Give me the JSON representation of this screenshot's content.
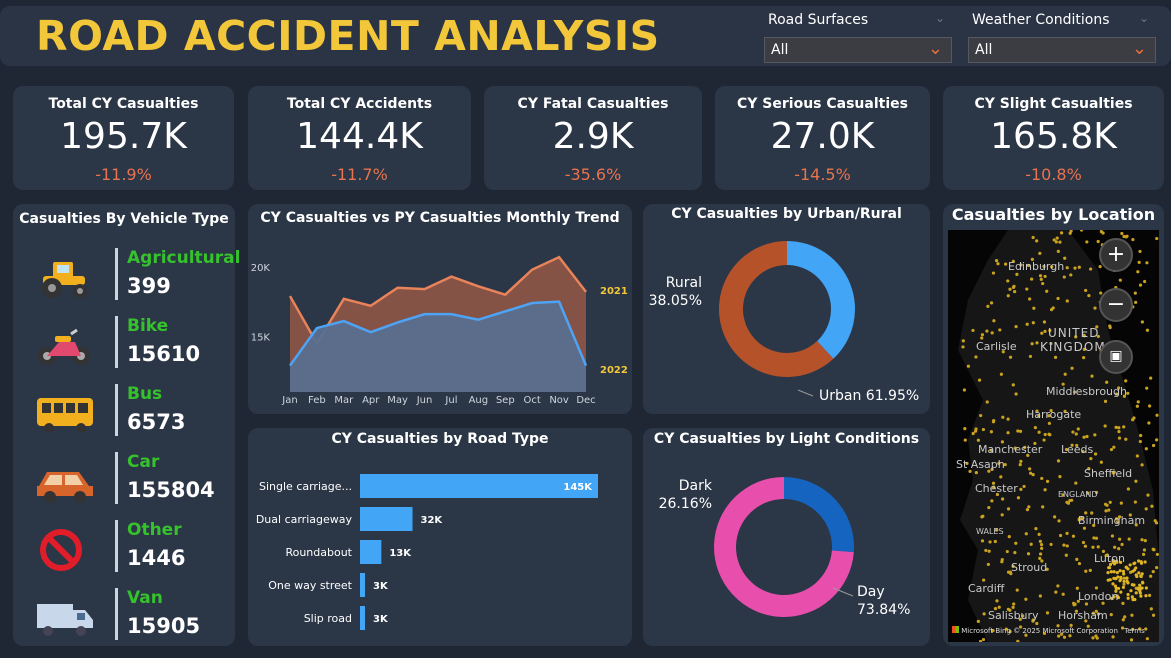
{
  "title": "ROAD ACCIDENT ANALYSIS",
  "slicers": [
    {
      "label": "Road Surfaces",
      "value": "All"
    },
    {
      "label": "Weather Conditions",
      "value": "All"
    }
  ],
  "kpis": [
    {
      "title": "Total CY Casualties",
      "value": "195.7K",
      "change": "-11.9%"
    },
    {
      "title": "Total CY Accidents",
      "value": "144.4K",
      "change": "-11.7%"
    },
    {
      "title": "CY Fatal Casualties",
      "value": "2.9K",
      "change": "-35.6%"
    },
    {
      "title": "CY Serious Casualties",
      "value": "27.0K",
      "change": "-14.5%"
    },
    {
      "title": "CY Slight Casualties",
      "value": "165.8K",
      "change": "-10.8%"
    }
  ],
  "vehicles": {
    "title": "Casualties By Vehicle Type",
    "items": [
      {
        "name": "Agricultural",
        "value": "399",
        "icon": "tractor-icon"
      },
      {
        "name": "Bike",
        "value": "15610",
        "icon": "motorbike-icon"
      },
      {
        "name": "Bus",
        "value": "6573",
        "icon": "bus-icon"
      },
      {
        "name": "Car",
        "value": "155804",
        "icon": "car-icon"
      },
      {
        "name": "Other",
        "value": "1446",
        "icon": "prohibited-icon"
      },
      {
        "name": "Van",
        "value": "15905",
        "icon": "van-icon"
      }
    ]
  },
  "chart_data": [
    {
      "type": "area",
      "title": "CY Casualties vs PY Casualties Monthly Trend",
      "categories": [
        "Jan",
        "Feb",
        "Mar",
        "Apr",
        "May",
        "Jun",
        "Jul",
        "Aug",
        "Sep",
        "Oct",
        "Nov",
        "Dec"
      ],
      "y_ticks": [
        "20K",
        "15K"
      ],
      "ylim": [
        11000,
        21500
      ],
      "series": [
        {
          "name": "2021",
          "color": "#e8835a",
          "values": [
            17900,
            14500,
            17700,
            17200,
            18500,
            18400,
            19300,
            18600,
            18000,
            19800,
            20700,
            18200
          ]
        },
        {
          "name": "2022",
          "color": "#4ea3f5",
          "values": [
            12900,
            15600,
            16100,
            15300,
            16000,
            16600,
            16600,
            16200,
            16800,
            17400,
            17500,
            12900
          ]
        }
      ]
    },
    {
      "type": "pie",
      "title": "CY Casualties by Urban/Rural",
      "slices": [
        {
          "label": "Rural",
          "value": 38.05,
          "display": "38.05%",
          "color": "#42a5f5"
        },
        {
          "label": "Urban",
          "value": 61.95,
          "display": "61.95%",
          "color": "#b5522a"
        }
      ]
    },
    {
      "type": "bar",
      "title": "CY Casualties by Road Type",
      "categories": [
        "Single carriage...",
        "Dual carriageway",
        "Roundabout",
        "One way street",
        "Slip road"
      ],
      "values": [
        145000,
        32000,
        13000,
        3000,
        3000
      ],
      "labels": [
        "145K",
        "32K",
        "13K",
        "3K",
        "3K"
      ]
    },
    {
      "type": "pie",
      "title": "CY Casualties by Light Conditions",
      "slices": [
        {
          "label": "Dark",
          "value": 26.16,
          "display": "26.16%",
          "color": "#1565c0"
        },
        {
          "label": "Day",
          "value": 73.84,
          "display": "73.84%",
          "color": "#e84fad"
        }
      ]
    }
  ],
  "map": {
    "title": "Casualties by Location",
    "places": [
      "Edinburgh",
      "UNITED",
      "KINGDOM",
      "Carlisle",
      "Middlesbrough",
      "Harrogate",
      "Manchester",
      "Leeds",
      "St Asaph",
      "Sheffield",
      "Chester",
      "ENGLAND",
      "Birmingham",
      "WALES",
      "Stroud",
      "Luton",
      "Cardiff",
      "London",
      "Salisbury",
      "Horsham"
    ],
    "attribution": "© 2025 Microsoft Corporation",
    "brand": "Microsoft Bing",
    "terms": "Terms"
  }
}
